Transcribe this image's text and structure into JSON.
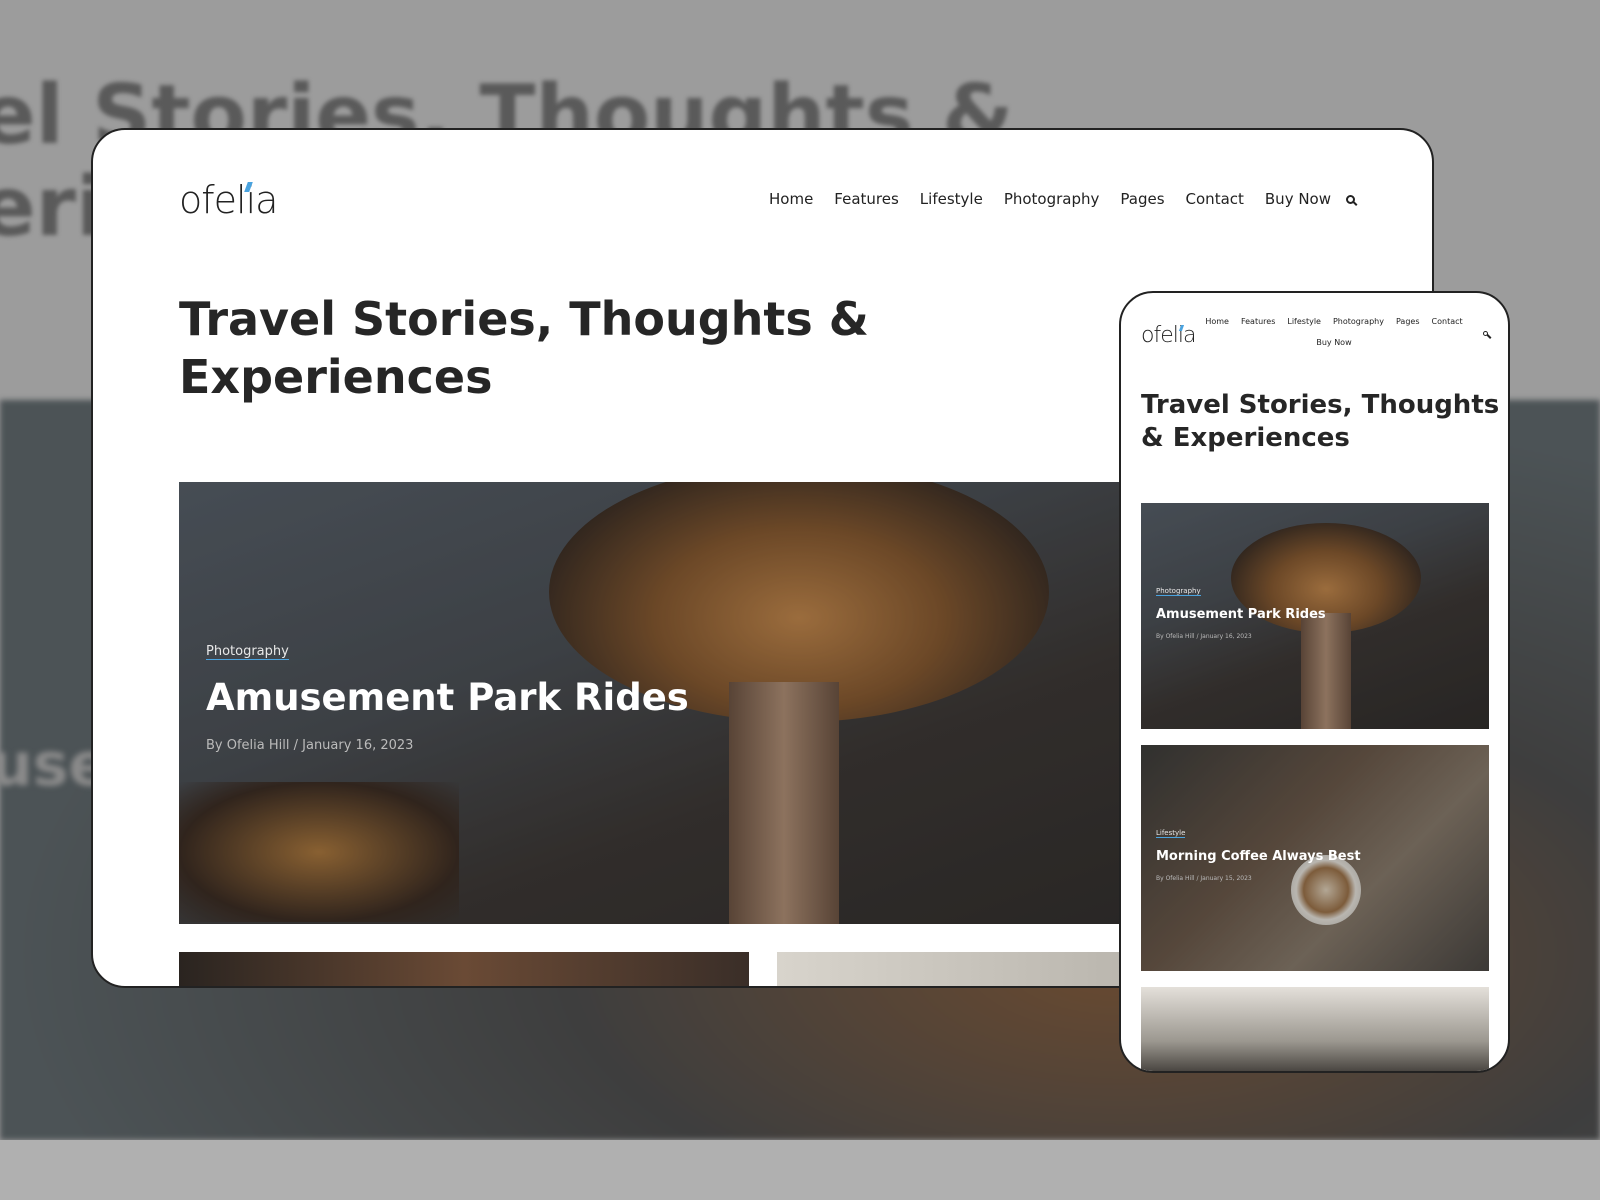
{
  "brand": {
    "logo": "ofelia",
    "accent": "#4aa3df"
  },
  "nav": {
    "items": [
      "Home",
      "Features",
      "Lifestyle",
      "Photography",
      "Pages",
      "Contact",
      "Buy Now"
    ],
    "search_icon": "search-icon"
  },
  "page": {
    "title": "Travel Stories, Thoughts & Experiences",
    "title_line1": "Travel Stories, Thoughts &",
    "title_line2": "Experiences"
  },
  "background": {
    "title_line1": "el Stories, Thoughts &",
    "title_line2": "eri",
    "hero_word": "use"
  },
  "posts": [
    {
      "category": "Photography",
      "title": "Amusement Park Rides",
      "author": "By Ofelia Hill",
      "date": "/ January 16, 2023"
    },
    {
      "category": "Lifestyle",
      "title": "Morning Coffee Always Best",
      "author": "By Ofelia Hill",
      "date": "/ January 15, 2023"
    }
  ],
  "mobile": {
    "title_line1": "Travel Stories, Thoughts",
    "title_line2": "& Experiences"
  }
}
